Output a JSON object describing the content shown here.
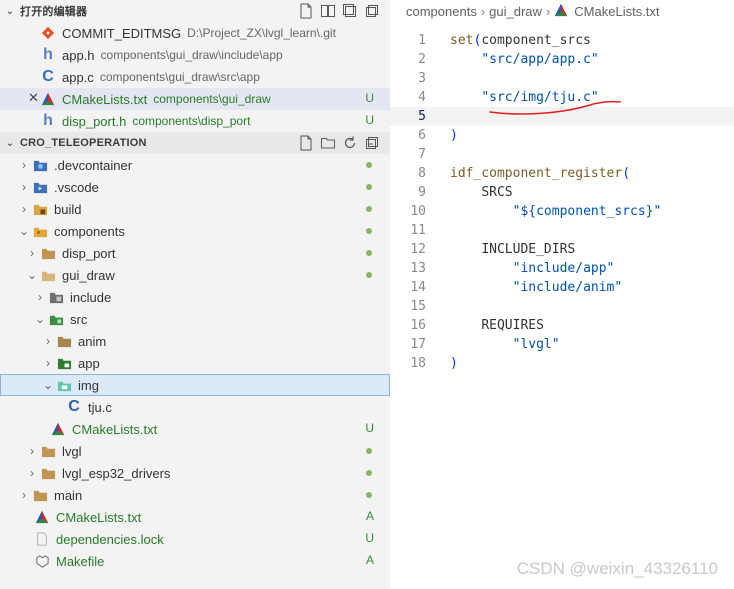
{
  "open_editors": {
    "title": "打开的编辑器",
    "items": [
      {
        "name": "COMMIT_EDITMSG",
        "desc": "D:\\Project_ZX\\lvgl_learn\\.git",
        "icon": "git-icon",
        "badge": ""
      },
      {
        "name": "app.h",
        "desc": "components\\gui_draw\\include\\app",
        "icon": "h-file-icon",
        "badge": ""
      },
      {
        "name": "app.c",
        "desc": "components\\gui_draw\\src\\app",
        "icon": "c-file-icon",
        "badge": ""
      },
      {
        "name": "CMakeLists.txt",
        "desc": "components\\gui_draw",
        "icon": "cmake-icon",
        "badge": "U"
      },
      {
        "name": "disp_port.h",
        "desc": "components\\disp_port",
        "icon": "h-file-icon",
        "badge": "U"
      }
    ]
  },
  "project": {
    "title": "CRO_TELEOPERATION",
    "tree": [
      {
        "name": ".devcontainer",
        "badge": "dot"
      },
      {
        "name": ".vscode",
        "badge": "dot"
      },
      {
        "name": "build",
        "badge": "dot"
      },
      {
        "name": "components",
        "badge": "dot"
      },
      {
        "name": "disp_port",
        "badge": "dot"
      },
      {
        "name": "gui_draw",
        "badge": "dot"
      },
      {
        "name": "include",
        "badge": ""
      },
      {
        "name": "src",
        "badge": ""
      },
      {
        "name": "anim",
        "badge": ""
      },
      {
        "name": "app",
        "badge": ""
      },
      {
        "name": "img",
        "badge": ""
      },
      {
        "name": "tju.c",
        "badge": ""
      },
      {
        "name": "CMakeLists.txt",
        "badge": "U"
      },
      {
        "name": "lvgl",
        "badge": "dot"
      },
      {
        "name": "lvgl_esp32_drivers",
        "badge": "dot"
      },
      {
        "name": "main",
        "badge": "dot"
      },
      {
        "name": "CMakeLists.txt",
        "badge": "A"
      },
      {
        "name": "dependencies.lock",
        "badge": "U"
      },
      {
        "name": "Makefile",
        "badge": "A"
      }
    ]
  },
  "breadcrumb": [
    "components",
    "gui_draw",
    "CMakeLists.txt"
  ],
  "code": {
    "line_numbers": [
      "1",
      "2",
      "3",
      "4",
      "5",
      "6",
      "7",
      "8",
      "9",
      "10",
      "11",
      "12",
      "13",
      "14",
      "15",
      "16",
      "17",
      "18"
    ],
    "current_line": "5",
    "lines": {
      "l1_fn": "set",
      "l1_rest": "component_srcs",
      "l2": "\"src/app/app.c\"",
      "l4": "\"src/img/tju.c\"",
      "l6": ")",
      "l8_fn": "idf_component_register",
      "l9": "SRCS",
      "l10": "\"${component_srcs}\"",
      "l12": "INCLUDE_DIRS",
      "l13": "\"include/app\"",
      "l14": "\"include/anim\"",
      "l16": "REQUIRES",
      "l17": "\"lvgl\"",
      "l18": ")"
    }
  },
  "watermark": "CSDN @weixin_43326110",
  "colors": {
    "accent": "#0451a5",
    "git_untracked": "#2a7a2a",
    "annotation": "#e02020"
  }
}
